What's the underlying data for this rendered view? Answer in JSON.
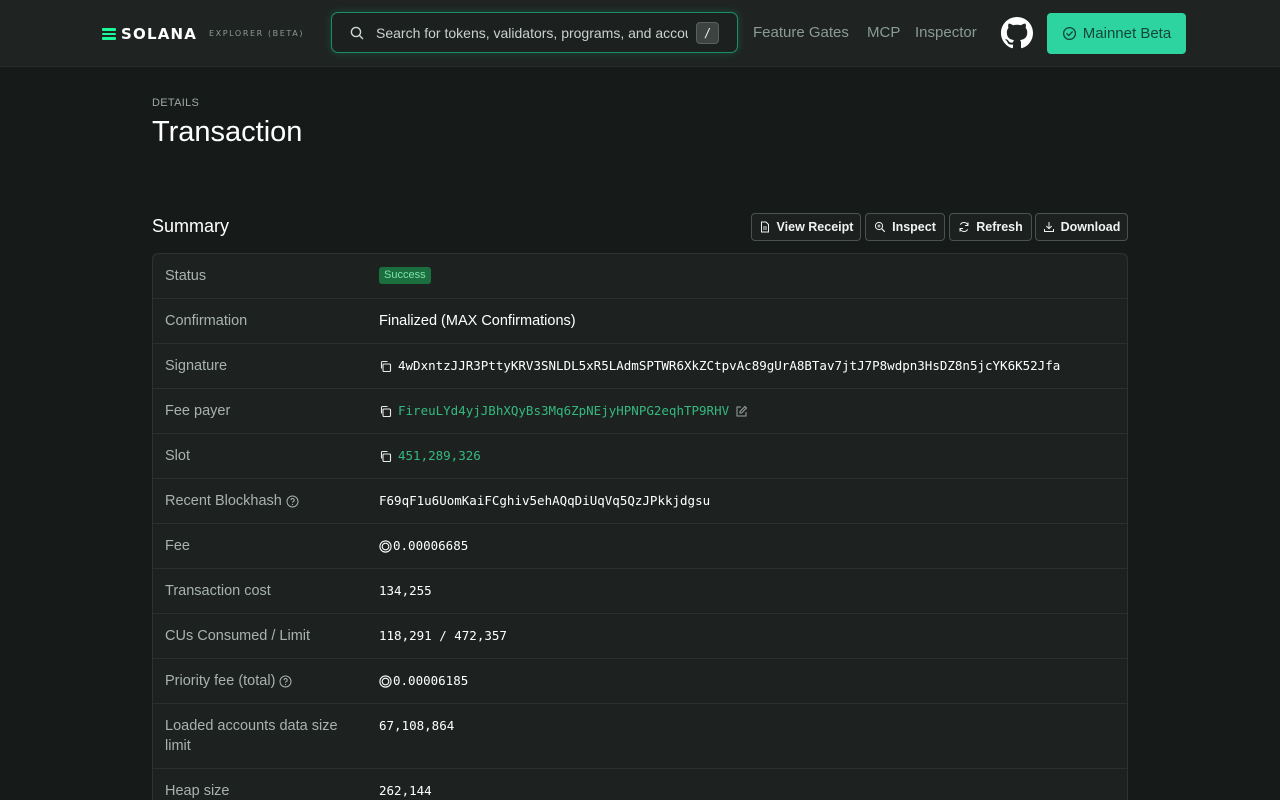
{
  "header": {
    "brand": "SOLANA",
    "brand_sub": "EXPLORER (BETA)",
    "search_placeholder": "Search for tokens, validators, programs, and accounts",
    "search_shortcut": "/",
    "nav": [
      "Feature Gates",
      "MCP",
      "Inspector"
    ],
    "cluster_label": "Mainnet Beta",
    "accent": "#19fb9b"
  },
  "page": {
    "pretitle": "DETAILS",
    "title": "Transaction"
  },
  "summary": {
    "title": "Summary",
    "actions": [
      "View Receipt",
      "Inspect",
      "Refresh",
      "Download"
    ],
    "rows": [
      {
        "label": "Status",
        "value": "Success"
      },
      {
        "label": "Confirmation",
        "value": "Finalized (MAX Confirmations)"
      },
      {
        "label": "Signature",
        "value": "4wDxntzJJR3PttyKRV3SNLDL5xR5LAdmSPTWR6XkZCtpvAc89gUrA8BTav7jtJ7P8wdpn3HsDZ8n5jcYK6K52Jfa"
      },
      {
        "label": "Fee payer",
        "value": "FireuLYd4yjJBhXQyBs3Mq6ZpNEjyHPNPG2eqhTP9RHV"
      },
      {
        "label": "Slot",
        "value": "451,289,326"
      },
      {
        "label": "Recent Blockhash",
        "value": "F69qF1u6UomKaiFCghiv5ehAQqDiUqVq5QzJPkkjdgsu"
      },
      {
        "label": "Fee",
        "value": "0.00006685"
      },
      {
        "label": "Transaction cost",
        "value": "134,255"
      },
      {
        "label": "CUs Consumed / Limit",
        "value": "118,291 / 472,357"
      },
      {
        "label": "Priority fee (total)",
        "value": "0.00006185"
      },
      {
        "label": "Loaded accounts data size limit",
        "value": "67,108,864"
      },
      {
        "label": "Heap size",
        "value": "262,144"
      }
    ]
  },
  "colors": {
    "background": "#161a19",
    "card": "#1d2221",
    "link": "#35b87f",
    "success_badge": "#1b6f3f",
    "cluster_button": "#2dd4a0"
  }
}
